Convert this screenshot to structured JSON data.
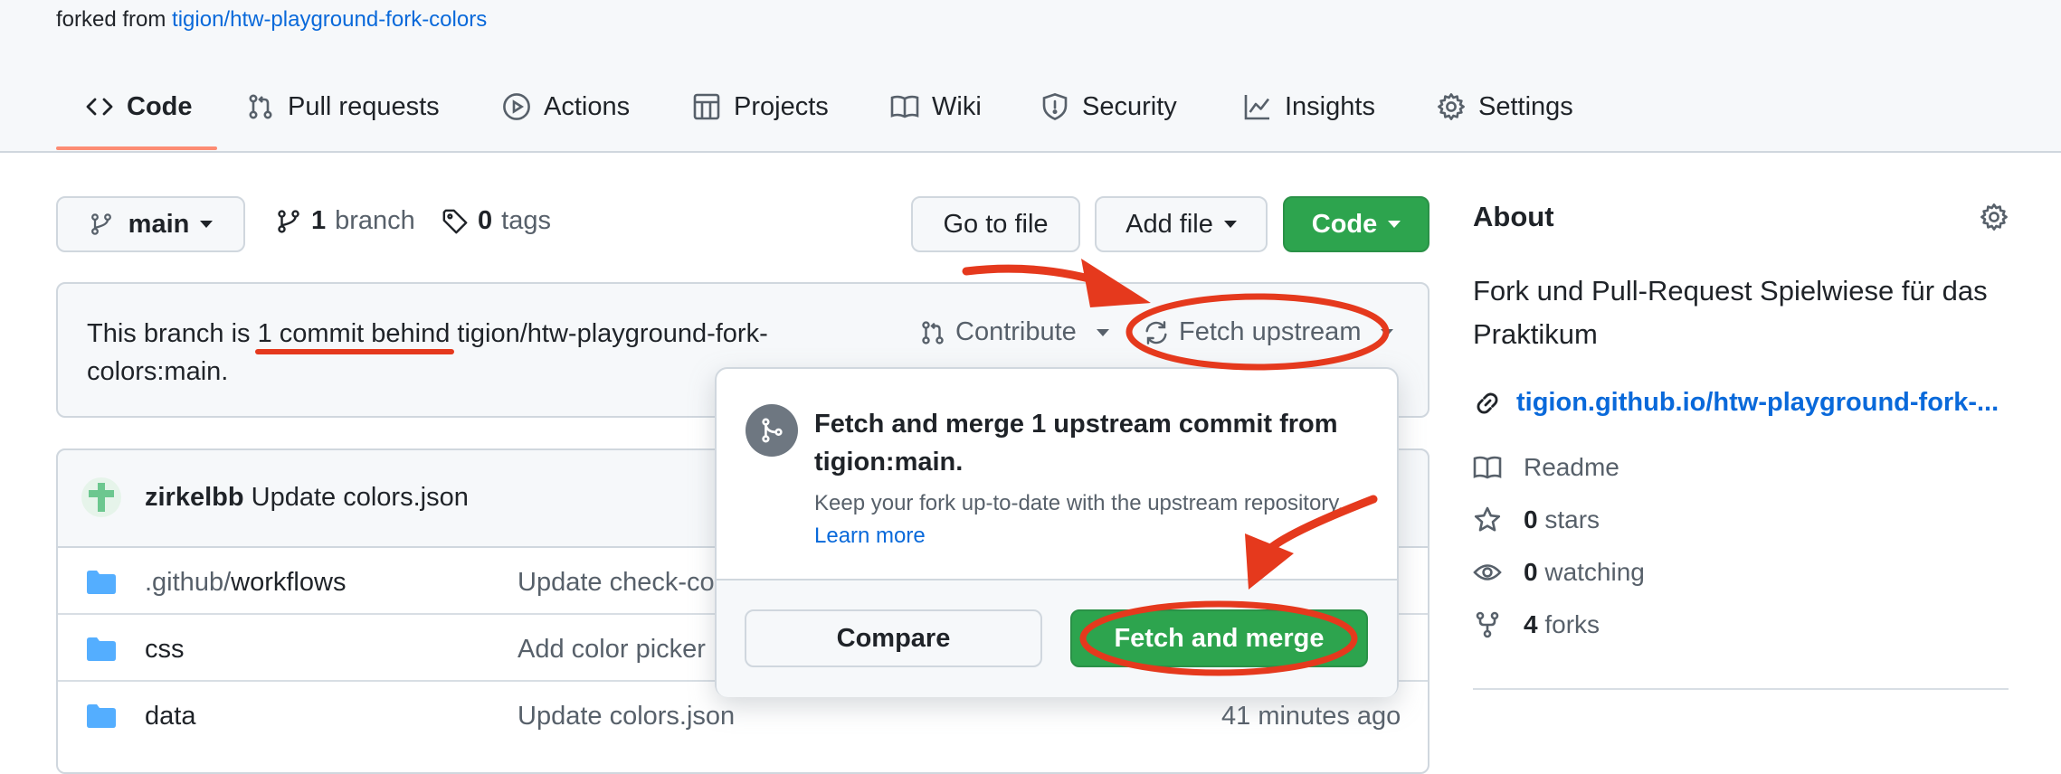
{
  "header": {
    "forked_prefix": "forked from",
    "forked_repo": "tigion/htw-playground-fork-colors"
  },
  "tabs": [
    {
      "label": "Code",
      "icon": "code-icon",
      "active": true
    },
    {
      "label": "Pull requests",
      "icon": "pull-request-icon"
    },
    {
      "label": "Actions",
      "icon": "play-icon"
    },
    {
      "label": "Projects",
      "icon": "table-icon"
    },
    {
      "label": "Wiki",
      "icon": "book-icon"
    },
    {
      "label": "Security",
      "icon": "shield-icon"
    },
    {
      "label": "Insights",
      "icon": "graph-icon"
    },
    {
      "label": "Settings",
      "icon": "gear-icon"
    }
  ],
  "toolbar": {
    "branch": "main",
    "branch_count": "1",
    "branch_label": "branch",
    "tag_count": "0",
    "tag_label": "tags",
    "goto_file": "Go to file",
    "add_file": "Add file",
    "code": "Code"
  },
  "behind_bar": {
    "prefix": "This branch is",
    "highlight": "1 commit behind",
    "suffix": "tigion/htw-playground-fork-colors:main.",
    "contribute": "Contribute",
    "fetch_upstream": "Fetch upstream"
  },
  "latest_commit": {
    "author": "zirkelbb",
    "message": "Update colors.json"
  },
  "files": [
    {
      "name_prefix": ".github/",
      "name": "workflows",
      "message": "Update check-co",
      "time": ""
    },
    {
      "name_prefix": "",
      "name": "css",
      "message": "Add color picker",
      "time": ""
    },
    {
      "name_prefix": "",
      "name": "data",
      "message": "Update colors.json",
      "time": "41 minutes ago"
    }
  ],
  "popover": {
    "title": "Fetch and merge 1 upstream commit from tigion:main.",
    "description": "Keep your fork up-to-date with the upstream repository.",
    "learn_more": "Learn more",
    "compare": "Compare",
    "fetch_merge": "Fetch and merge"
  },
  "about": {
    "title": "About",
    "description": "Fork und Pull-Request Spielwiese für das Praktikum",
    "link": "tigion.github.io/htw-playground-fork-...",
    "readme": "Readme",
    "stars_count": "0",
    "stars_label": "stars",
    "watching_count": "0",
    "watching_label": "watching",
    "forks_count": "4",
    "forks_label": "forks"
  },
  "colors": {
    "accent_blue": "#0969da",
    "green_button": "#2da44e",
    "annotation_red": "#e5391d",
    "tab_underline": "#fd8c73"
  }
}
